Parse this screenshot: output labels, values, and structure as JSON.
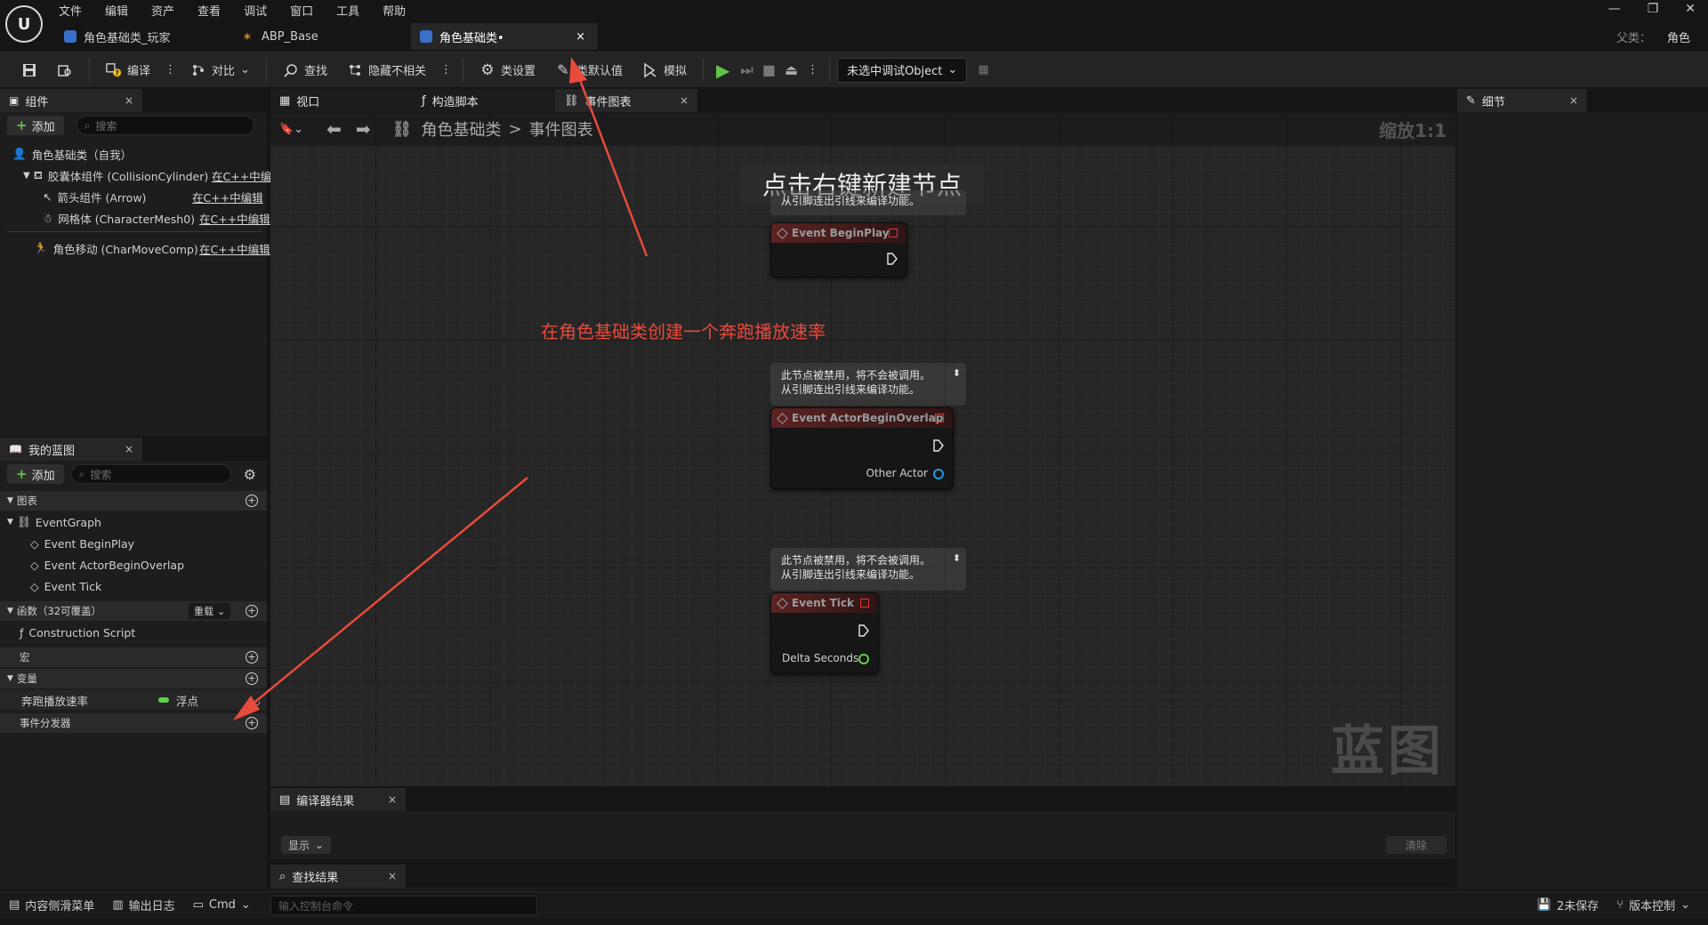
{
  "menu": [
    "文件",
    "编辑",
    "资产",
    "查看",
    "调试",
    "窗口",
    "工具",
    "帮助"
  ],
  "logo_text": "U",
  "doc_tabs": [
    {
      "label": "角色基础类_玩家"
    },
    {
      "label": "ABP_Base"
    },
    {
      "label": "角色基础类•",
      "close": "×"
    }
  ],
  "parent": {
    "label": "父类：",
    "value": "角色"
  },
  "toolbar": {
    "compile": "编译",
    "diff": "对比",
    "find": "查找",
    "hide_unrelated": "隐藏不相关",
    "class_settings": "类设置",
    "class_defaults": "类默认值",
    "simulate": "模拟",
    "debug_object": "未选中调试Object"
  },
  "components_panel": {
    "title": "组件",
    "add": "添加",
    "search_placeholder": "搜索",
    "items": [
      {
        "label": "角色基础类（自我）",
        "link": ""
      },
      {
        "label": "胶囊体组件 (CollisionCylinder)",
        "link": "在C++中编"
      },
      {
        "label": "箭头组件 (Arrow)",
        "link": "在C++中编辑"
      },
      {
        "label": "网格体 (CharacterMesh0)",
        "link": "在C++中编辑"
      },
      {
        "label": "角色移动 (CharMoveComp)",
        "link": "在C++中编辑"
      }
    ]
  },
  "my_blueprint": {
    "title": "我的蓝图",
    "add": "添加",
    "search_placeholder": "搜索",
    "graphs_label": "图表",
    "event_graph": "EventGraph",
    "events": [
      "Event BeginPlay",
      "Event ActorBeginOverlap",
      "Event Tick"
    ],
    "functions_label": "函数（32可覆盖）",
    "override": "重载",
    "construction_script": "Construction Script",
    "macros_label": "宏",
    "variables_label": "变量",
    "variable": {
      "name": "奔跑播放速率",
      "type": "浮点",
      "type_color": "#5fd14a"
    },
    "dispatchers_label": "事件分发器"
  },
  "graph_tabs": [
    {
      "label": "视口"
    },
    {
      "label": "构造脚本"
    },
    {
      "label": "事件图表",
      "close": "×"
    }
  ],
  "graph": {
    "breadcrumb_root": "角色基础类",
    "breadcrumb_sep": ">",
    "breadcrumb_leaf": "事件图表",
    "zoom": "缩放1:1",
    "watermark": "蓝图",
    "hint": "点击右键新建节点",
    "annotation": "在角色基础类创建一个奔跑播放速率",
    "disabled_comment_1": "此节点被禁用，将不会被调用。",
    "disabled_comment_2": "从引脚连出引线来编译功能。",
    "nodes": [
      {
        "title": "Event BeginPlay"
      },
      {
        "title": "Event ActorBeginOverlap",
        "pin": "Other Actor"
      },
      {
        "title": "Event Tick",
        "pin": "Delta Seconds"
      }
    ]
  },
  "details_panel": {
    "title": "细节"
  },
  "compiler_results": {
    "title": "编译器结果",
    "show": "显示",
    "clear": "清除"
  },
  "find_results": {
    "title": "查找结果"
  },
  "statusbar": {
    "content_drawer": "内容侧滑菜单",
    "output_log": "输出日志",
    "cmd": "Cmd",
    "console_placeholder": "输入控制台命令",
    "unsaved": "2未保存",
    "source_control": "版本控制"
  },
  "close_glyph": "×",
  "window_controls": [
    "—",
    "❐",
    "✕"
  ]
}
